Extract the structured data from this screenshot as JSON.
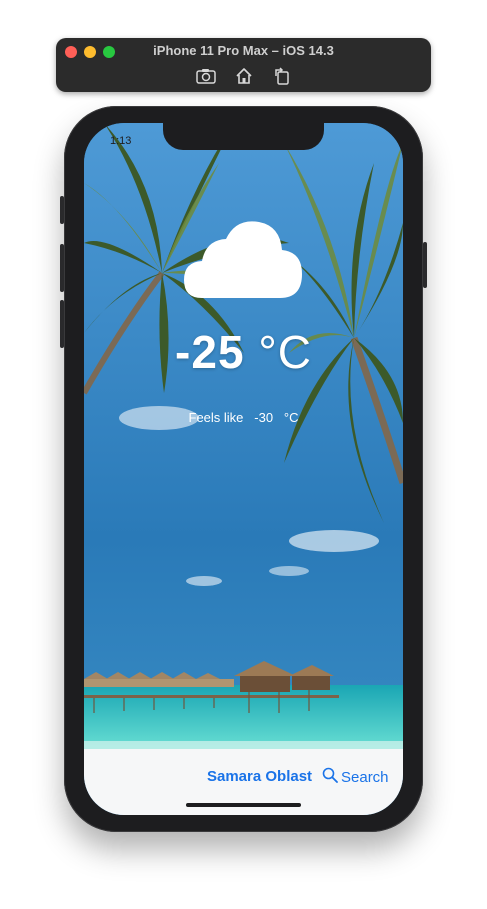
{
  "simulator": {
    "title": "iPhone 11 Pro Max – iOS 14.3",
    "tools": [
      "screenshot-icon",
      "home-icon",
      "rotate-icon"
    ]
  },
  "status_bar": {
    "time": "1:13"
  },
  "weather": {
    "icon": "cloud-icon",
    "temperature": "-25",
    "unit": "°C",
    "feels_like_label": "Feels like",
    "feels_like_value": "-30",
    "feels_like_unit": "°C"
  },
  "bottom_bar": {
    "region": "Samara Oblast",
    "search_label": "Search"
  },
  "colors": {
    "accent": "#1a73e8",
    "sky": "#2f7fb8",
    "sea": "#3fd3c8"
  }
}
